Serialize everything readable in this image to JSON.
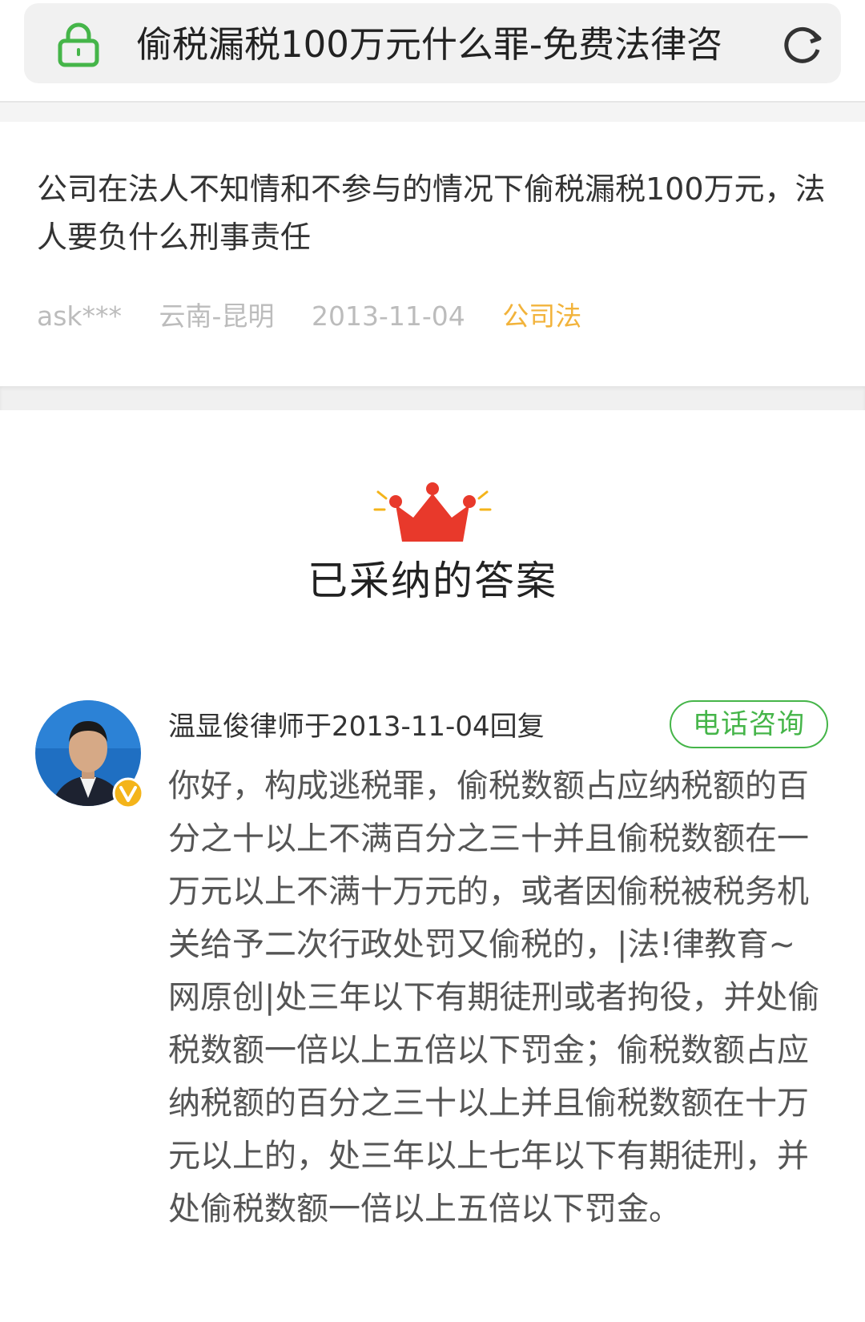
{
  "address_bar": {
    "title": "偷税漏税100万元什么罪-免费法律咨",
    "lock_icon": "lock-icon",
    "reload_icon": "reload-icon"
  },
  "question": {
    "text": "公司在法人不知情和不参与的情况下偷税漏税100万元，法人要负什么刑事责任",
    "asker": "ask***",
    "location": "云南-昆明",
    "date": "2013-11-04",
    "category": "公司法"
  },
  "answer": {
    "section_title": "已采纳的答案",
    "crown_icon": "crown-icon",
    "lawyer_reply_line": "温显俊律师于2013-11-04回复",
    "phone_button": "电话咨询",
    "verified_badge_icon": "verified-v-icon",
    "body": "你好，构成逃税罪，偷税数额占应纳税额的百分之十以上不满百分之三十并且偷税数额在一万元以上不满十万元的，或者因偷税被税务机关给予二次行政处罚又偷税的，|法!律教育~网原创|处三年以下有期徒刑或者拘役，并处偷税数额一倍以上五倍以下罚金；偷税数额占应纳税额的百分之三十以上并且偷税数额在十万元以上的，处三年以上七年以下有期徒刑，并处偷税数额一倍以上五倍以下罚金。"
  },
  "colors": {
    "lock_green": "#45b549",
    "category_gold": "#f2b33b",
    "crown_red": "#e8392b",
    "phone_green": "#45b549",
    "badge_gold": "#f4b41a"
  }
}
